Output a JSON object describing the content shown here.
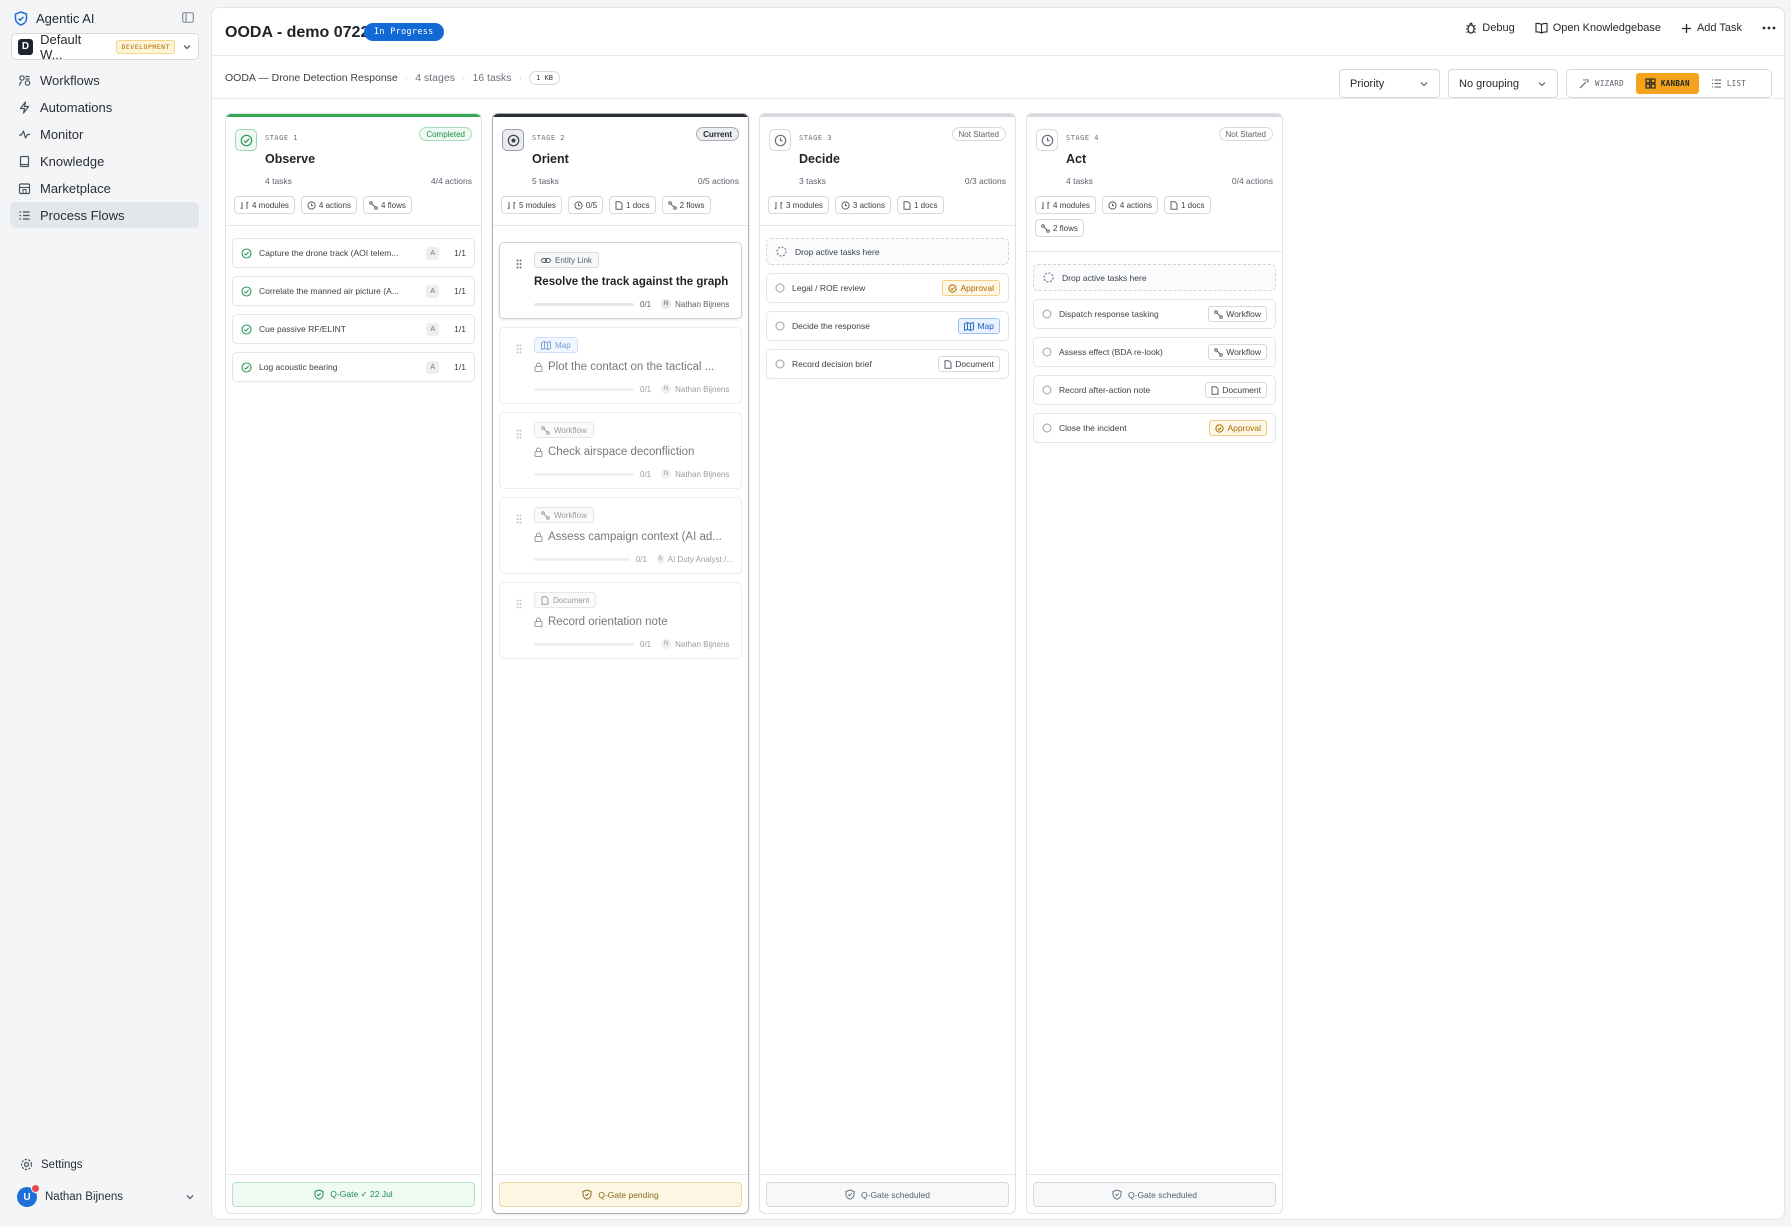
{
  "sidebar": {
    "brand": "Agentic AI",
    "workspace": {
      "initial": "D",
      "name": "Default W...",
      "env": "DEVELOPMENT"
    },
    "nav": [
      {
        "label": "Workflows",
        "icon": "workflows-icon"
      },
      {
        "label": "Automations",
        "icon": "lightning-icon"
      },
      {
        "label": "Monitor",
        "icon": "activity-icon"
      },
      {
        "label": "Knowledge",
        "icon": "book-icon"
      },
      {
        "label": "Marketplace",
        "icon": "store-icon"
      },
      {
        "label": "Process Flows",
        "icon": "list-icon",
        "active": true
      }
    ],
    "settings": "Settings",
    "user": {
      "initial": "U",
      "name": "Nathan Bijnens"
    }
  },
  "header": {
    "title": "OODA - demo 0722",
    "status": "In Progress",
    "actions": {
      "debug": "Debug",
      "knowledgebase": "Open Knowledgebase",
      "add_task": "Add Task"
    }
  },
  "subbar": {
    "flow_name": "OODA — Drone Detection Response",
    "stages": "4 stages",
    "tasks": "16 tasks",
    "kb": "1 KB",
    "sort": "Priority",
    "grouping": "No grouping",
    "views": {
      "wizard": "WIZARD",
      "kanban": "KANBAN",
      "list": "LIST",
      "active": "KANBAN"
    }
  },
  "columns": [
    {
      "stage": "STAGE 1",
      "name": "Observe",
      "status": "Completed",
      "tasks": "4 tasks",
      "actions": "4/4 actions",
      "chips": [
        "4 modules",
        "4 actions",
        "4 flows"
      ],
      "items": [
        {
          "name": "Capture the drone track (AOI telem...",
          "badge": "A",
          "progress": "1/1"
        },
        {
          "name": "Correlate the manned air picture (A...",
          "badge": "A",
          "progress": "1/1"
        },
        {
          "name": "Cue passive RF/ELINT",
          "badge": "A",
          "progress": "1/1"
        },
        {
          "name": "Log acoustic bearing",
          "badge": "A",
          "progress": "1/1"
        }
      ],
      "gate": "Q-Gate ✓ 22 Jul"
    },
    {
      "stage": "STAGE 2",
      "name": "Orient",
      "status": "Current",
      "tasks": "5 tasks",
      "actions": "0/5 actions",
      "chips": [
        "5 modules",
        "0/5",
        "1 docs",
        "2 flows"
      ],
      "cards": [
        {
          "type": "Entity Link",
          "title": "Resolve the track against the graph",
          "progress": "0/1",
          "assignee": "Nathan Bijnens",
          "initial": "N"
        },
        {
          "type": "Map",
          "title": "Plot the contact on the tactical ...",
          "progress": "0/1",
          "assignee": "Nathan Bijnens",
          "initial": "N"
        },
        {
          "type": "Workflow",
          "title": "Check airspace deconfliction",
          "progress": "0/1",
          "assignee": "Nathan Bijnens",
          "initial": "N"
        },
        {
          "type": "Workflow",
          "title": "Assess campaign context (AI ad...",
          "progress": "0/1",
          "assignee": "AI Duty Analyst /...",
          "initial": "A"
        },
        {
          "type": "Document",
          "title": "Record orientation note",
          "progress": "0/1",
          "assignee": "Nathan Bijnens",
          "initial": "N"
        }
      ],
      "gate": "Q-Gate pending"
    },
    {
      "stage": "STAGE 3",
      "name": "Decide",
      "status": "Not Started",
      "tasks": "3 tasks",
      "actions": "0/3 actions",
      "chips": [
        "3 modules",
        "3 actions",
        "1 docs"
      ],
      "drop": "Drop active tasks here",
      "items": [
        {
          "name": "Legal / ROE review",
          "type": "Approval"
        },
        {
          "name": "Decide the response",
          "type": "Map"
        },
        {
          "name": "Record decision brief",
          "type": "Document"
        }
      ],
      "gate": "Q-Gate scheduled"
    },
    {
      "stage": "STAGE 4",
      "name": "Act",
      "status": "Not Started",
      "tasks": "4 tasks",
      "actions": "0/4 actions",
      "chips": [
        "4 modules",
        "4 actions",
        "1 docs",
        "2 flows"
      ],
      "drop": "Drop active tasks here",
      "items": [
        {
          "name": "Dispatch response tasking",
          "type": "Workflow"
        },
        {
          "name": "Assess effect (BDA re-look)",
          "type": "Workflow"
        },
        {
          "name": "Record after-action note",
          "type": "Document"
        },
        {
          "name": "Close the incident",
          "type": "Approval"
        }
      ],
      "gate": "Q-Gate scheduled"
    }
  ]
}
